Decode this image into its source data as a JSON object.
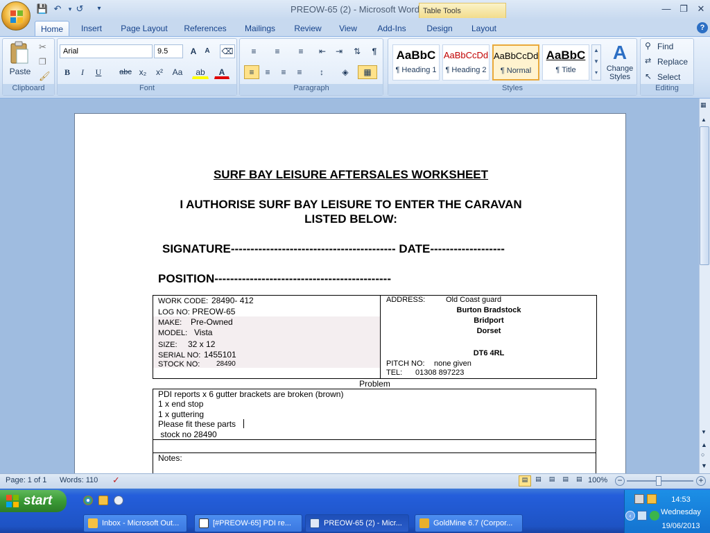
{
  "window": {
    "title": "PREOW-65 (2) - Microsoft Word",
    "table_tools_label": "Table Tools"
  },
  "tabs": [
    "Home",
    "Insert",
    "Page Layout",
    "References",
    "Mailings",
    "Review",
    "View",
    "Add-Ins",
    "Design",
    "Layout"
  ],
  "ribbon": {
    "clipboard": {
      "paste_label": "Paste",
      "group_label": "Clipboard"
    },
    "font": {
      "family": "Arial",
      "size": "9.5",
      "group_label": "Font",
      "bold": "B",
      "italic": "I",
      "underline": "U",
      "strike": "abc",
      "subscript": "x₂",
      "superscript": "x²",
      "change_case": "Aa",
      "grow": "A",
      "shrink": "A",
      "highlight": "ab",
      "font_color": "A"
    },
    "paragraph": {
      "group_label": "Paragraph",
      "show_marks": "¶"
    },
    "styles": {
      "group_label": "Styles",
      "tiles": [
        {
          "preview": "AaBbC",
          "name": "¶ Heading 1",
          "color": "#000000"
        },
        {
          "preview": "AaBbCcDd",
          "name": "¶ Heading 2",
          "color": "#c00000"
        },
        {
          "preview": "AaBbCcDd",
          "name": "¶ Normal",
          "color": "#000000"
        },
        {
          "preview": "AaBbC",
          "name": "¶ Title",
          "color": "#000000"
        }
      ],
      "change_styles": "Change Styles"
    },
    "editing": {
      "group_label": "Editing",
      "find": "Find",
      "replace": "Replace",
      "select": "Select"
    }
  },
  "document": {
    "title": "SURF BAY LEISURE AFTERSALES WORKSHEET",
    "authorise_line1": "I AUTHORISE SURF BAY LEISURE TO ENTER THE CARAVAN",
    "authorise_line2": "LISTED BELOW:",
    "signature_line": "SIGNATURE------------------------------------------ DATE-------------------",
    "position_line": "POSITION---------------------------------------------",
    "left_fields": [
      {
        "label": "WORK CODE:",
        "value": "28490-  412"
      },
      {
        "label": "LOG NO:",
        "value": "PREOW-65"
      },
      {
        "label": "MAKE:",
        "value": "Pre-Owned"
      },
      {
        "label": "MODEL:",
        "value": "Vista"
      },
      {
        "label": "SIZE:",
        "value": "32 x 12"
      },
      {
        "label": "SERIAL NO:",
        "value": "1455101"
      },
      {
        "label": "STOCK NO:",
        "value": "28490"
      }
    ],
    "address_label": "ADDRESS:",
    "address_line1": "Old Coast guard",
    "address_line2": "Burton Bradstock",
    "address_line3": "Bridport",
    "address_line4": "Dorset",
    "postcode": "DT6 4RL",
    "pitch_label": "PITCH NO:",
    "pitch_value": "none given",
    "tel_label": "TEL:",
    "tel_value": "01308 897223",
    "problem_heading": "Problem",
    "problem_lines": [
      "PDI reports x 6 gutter brackets are broken (brown)",
      "1 x end stop",
      "1 x guttering",
      "Please fit these parts",
      " stock no 28490"
    ],
    "notes_label": "Notes:"
  },
  "statusbar": {
    "page": "Page: 1 of 1",
    "words": "Words: 110",
    "zoom": "100%"
  },
  "taskbar": {
    "start": "start",
    "items": [
      "Inbox - Microsoft Out...",
      "[#PREOW-65] PDI re...",
      "PREOW-65 (2) - Micr...",
      "GoldMine 6.7 (Corpor..."
    ],
    "clock": "14:53",
    "day": "Wednesday",
    "date": "19/06/2013"
  }
}
